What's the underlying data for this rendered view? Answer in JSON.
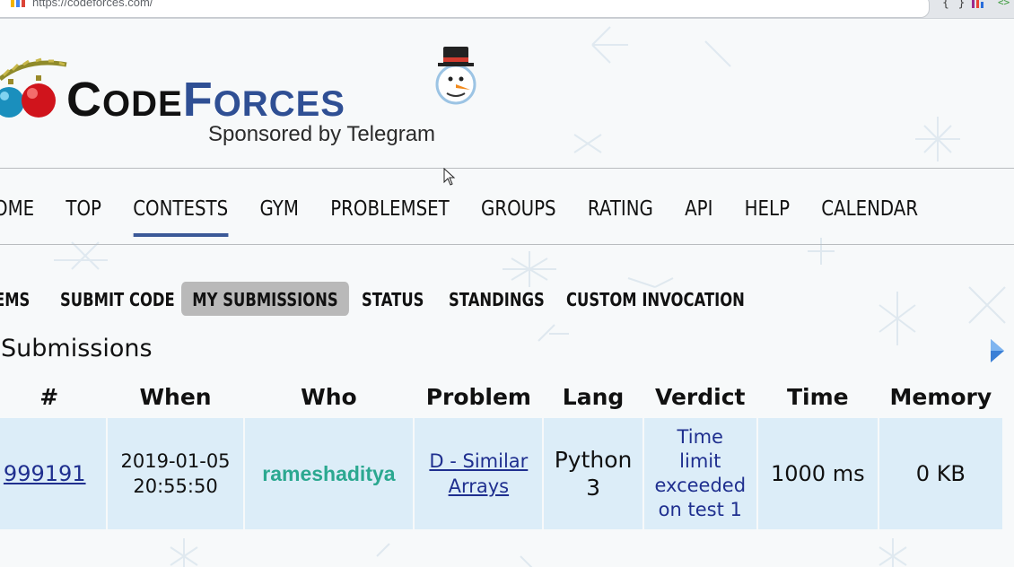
{
  "browser": {
    "url": "https://codeforces.com/",
    "extension_braces": "{ }",
    "extension_tag": "<>"
  },
  "logo": {
    "code_initial": "C",
    "code_rest": "ODE",
    "forces_initial": "F",
    "forces_rest": "ORCES",
    "sponsor": "Sponsored by Telegram"
  },
  "main_nav": {
    "items": [
      {
        "label": "HOME",
        "shown": "OME",
        "active": false
      },
      {
        "label": "TOP",
        "active": false
      },
      {
        "label": "CONTESTS",
        "active": true
      },
      {
        "label": "GYM",
        "active": false
      },
      {
        "label": "PROBLEMSET",
        "active": false
      },
      {
        "label": "GROUPS",
        "active": false
      },
      {
        "label": "RATING",
        "active": false
      },
      {
        "label": "API",
        "active": false
      },
      {
        "label": "HELP",
        "active": false
      },
      {
        "label": "CALENDAR",
        "active": false
      }
    ]
  },
  "sub_nav": {
    "items": [
      {
        "label": "EMS",
        "active": false
      },
      {
        "label": "SUBMIT CODE",
        "active": false
      },
      {
        "label": "MY SUBMISSIONS",
        "active": true
      },
      {
        "label": "STATUS",
        "active": false
      },
      {
        "label": "STANDINGS",
        "active": false
      },
      {
        "label": "CUSTOM INVOCATION",
        "active": false
      }
    ]
  },
  "section": {
    "title": "Submissions"
  },
  "table": {
    "columns": [
      "#",
      "When",
      "Who",
      "Problem",
      "Lang",
      "Verdict",
      "Time",
      "Memory"
    ],
    "rows": [
      {
        "id": "999191",
        "when_date": "2019-01-05",
        "when_time": "20:55:50",
        "who": "rameshaditya",
        "problem_line1": "D - Similar",
        "problem_line2": "Arrays",
        "lang_line1": "Python",
        "lang_line2": "3",
        "verdict_line1": "Time",
        "verdict_line2": "limit",
        "verdict_line3": "exceeded",
        "verdict_line4": "on test 1",
        "time": "1000 ms",
        "memory": "0 KB"
      }
    ]
  },
  "colors": {
    "accent": "#3b5998",
    "row_bg": "#dcedf8",
    "link": "#1f2f8f",
    "user_handle": "#2ba890",
    "active_subtab": "#b9b9b9"
  }
}
